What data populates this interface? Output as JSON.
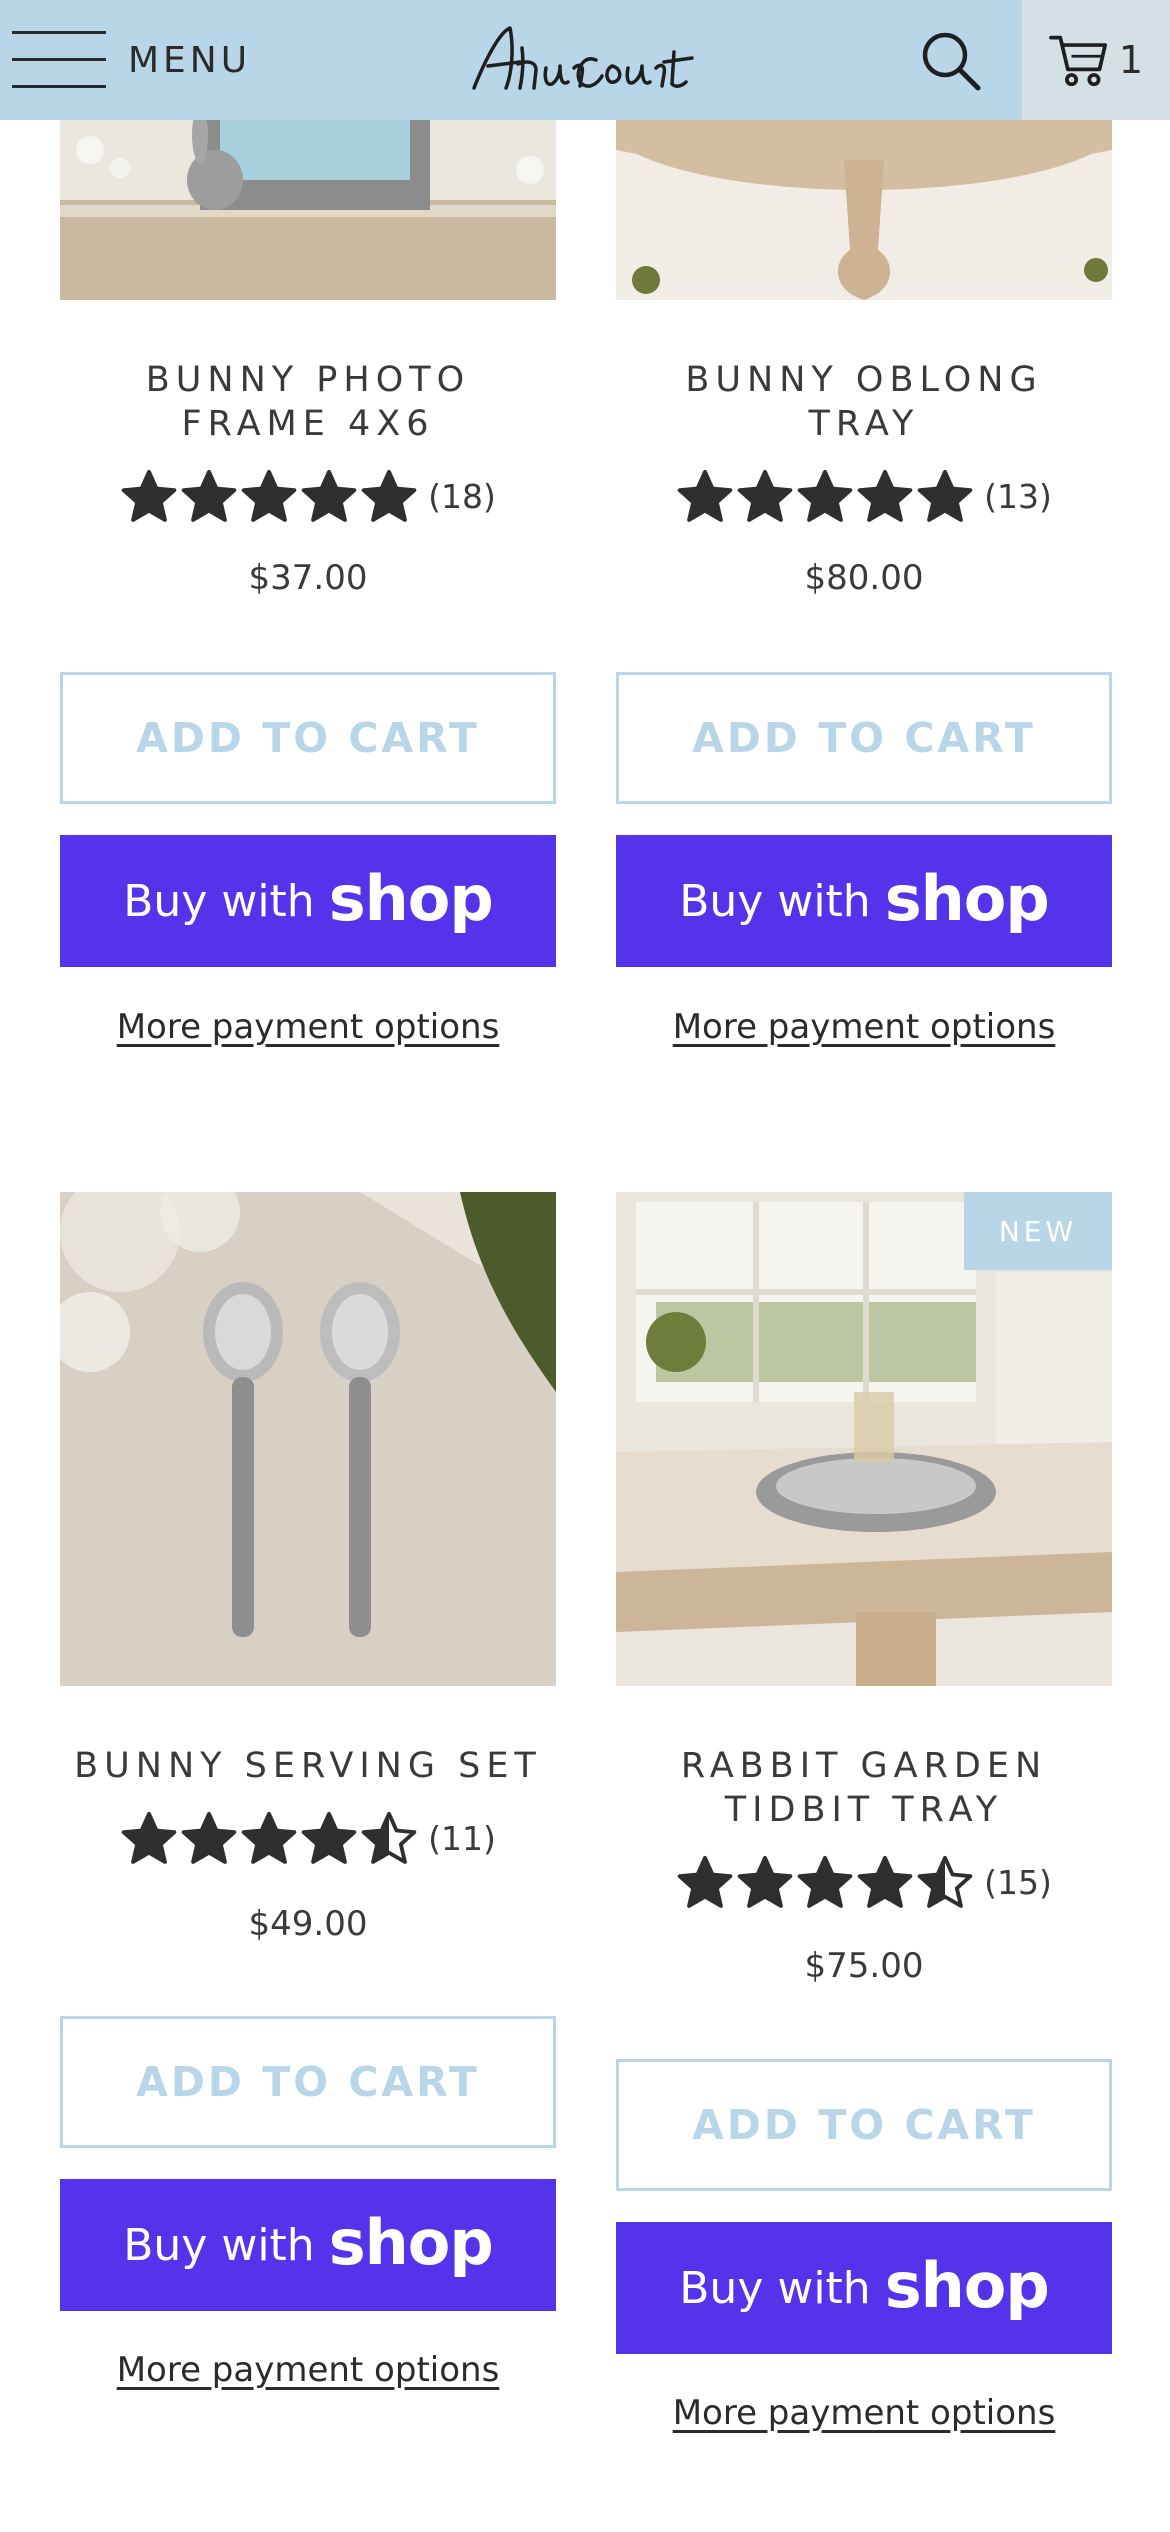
{
  "header": {
    "menu_label": "MENU",
    "logo_text": "Arthur Court",
    "cart_count": "1"
  },
  "colors": {
    "header_bg": "#b8d6e8",
    "accent": "#b8d6e8",
    "shop_purple": "#5433eb"
  },
  "products": [
    {
      "title": "BUNNY PHOTO FRAME 4X6",
      "rating": 5,
      "review_count": "(18)",
      "price": "$37.00",
      "add_to_cart": "ADD TO CART",
      "buy_with": "Buy with",
      "shop": "shop",
      "more_payment": "More payment options"
    },
    {
      "title": "BUNNY OBLONG TRAY",
      "rating": 5,
      "review_count": "(13)",
      "price": "$80.00",
      "add_to_cart": "ADD TO CART",
      "buy_with": "Buy with",
      "shop": "shop",
      "more_payment": "More payment options"
    },
    {
      "title": "BUNNY SERVING SET",
      "rating": 4.5,
      "review_count": "(11)",
      "price": "$49.00",
      "add_to_cart": "ADD TO CART",
      "buy_with": "Buy with",
      "shop": "shop",
      "more_payment": "More payment options"
    },
    {
      "title": "RABBIT GARDEN TIDBIT TRAY",
      "badge": "NEW",
      "rating": 4.5,
      "review_count": "(15)",
      "price": "$75.00",
      "add_to_cart": "ADD TO CART",
      "buy_with": "Buy with",
      "shop": "shop",
      "more_payment": "More payment options"
    }
  ]
}
